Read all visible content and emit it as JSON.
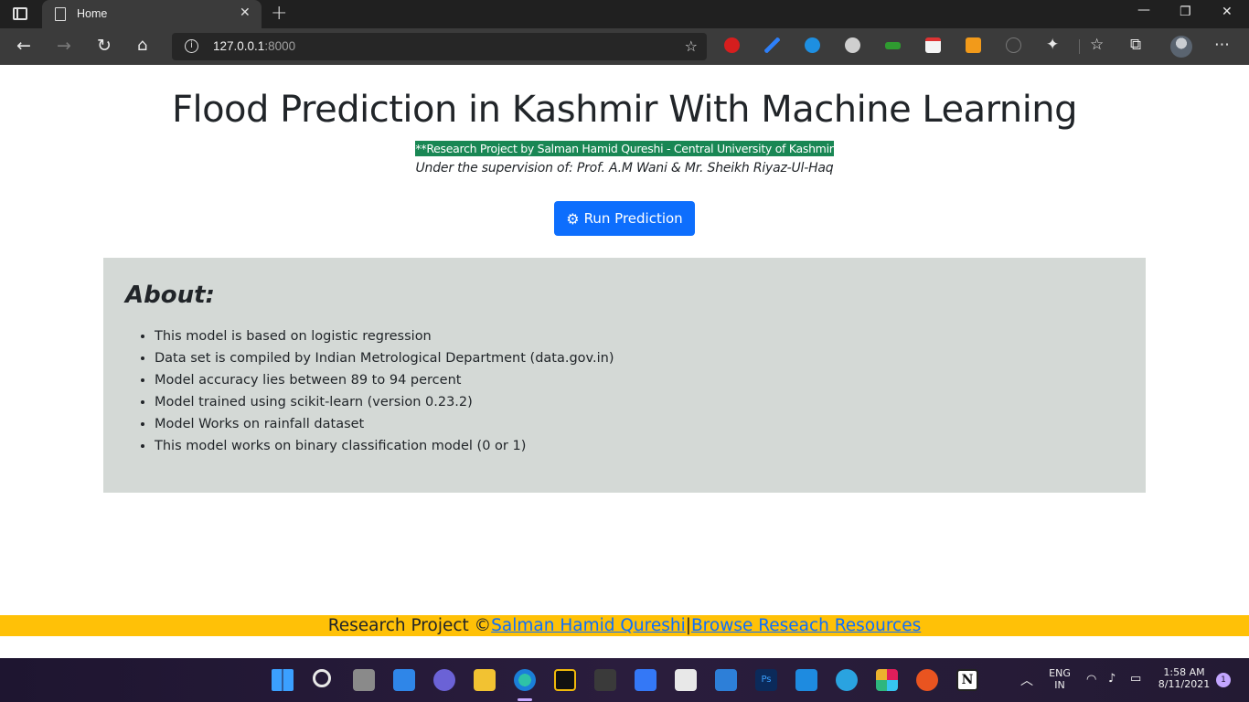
{
  "browser": {
    "tab_title": "Home",
    "url_host": "127.0.0.1",
    "url_port": ":8000"
  },
  "page": {
    "title": "Flood Prediction in Kashmir With Machine Learning",
    "credit": "**Research Project by Salman Hamid Qureshi - Central University of Kashmir",
    "supervision": "Under the supervision of: Prof. A.M Wani & Mr. Sheikh Riyaz-Ul-Haq",
    "run_button_label": "Run Prediction",
    "about": {
      "heading": "About:",
      "items": [
        "This model is based on logistic regression",
        "Data set is compiled by Indian Metrological Department (data.gov.in)",
        "Model accuracy lies between 89 to 94 percent",
        "Model trained using scikit-learn (version 0.23.2)",
        "Model Works on rainfall dataset",
        "This model works on binary classification model (0 or 1)"
      ]
    },
    "footer": {
      "prefix": "Research Project ©",
      "author_link": "Salman Hamid Qureshi",
      "separator": "|",
      "resources_link": "Browse Reseach Resources"
    }
  },
  "taskbar": {
    "lang_top": "ENG",
    "lang_bottom": "IN",
    "time": "1:58 AM",
    "date": "8/11/2021",
    "notification_count": "1"
  },
  "colors": {
    "primary_button": "#0d6efd",
    "credit_bg": "#198754",
    "about_bg": "#d4d9d6",
    "footer_bg": "#ffc107"
  }
}
